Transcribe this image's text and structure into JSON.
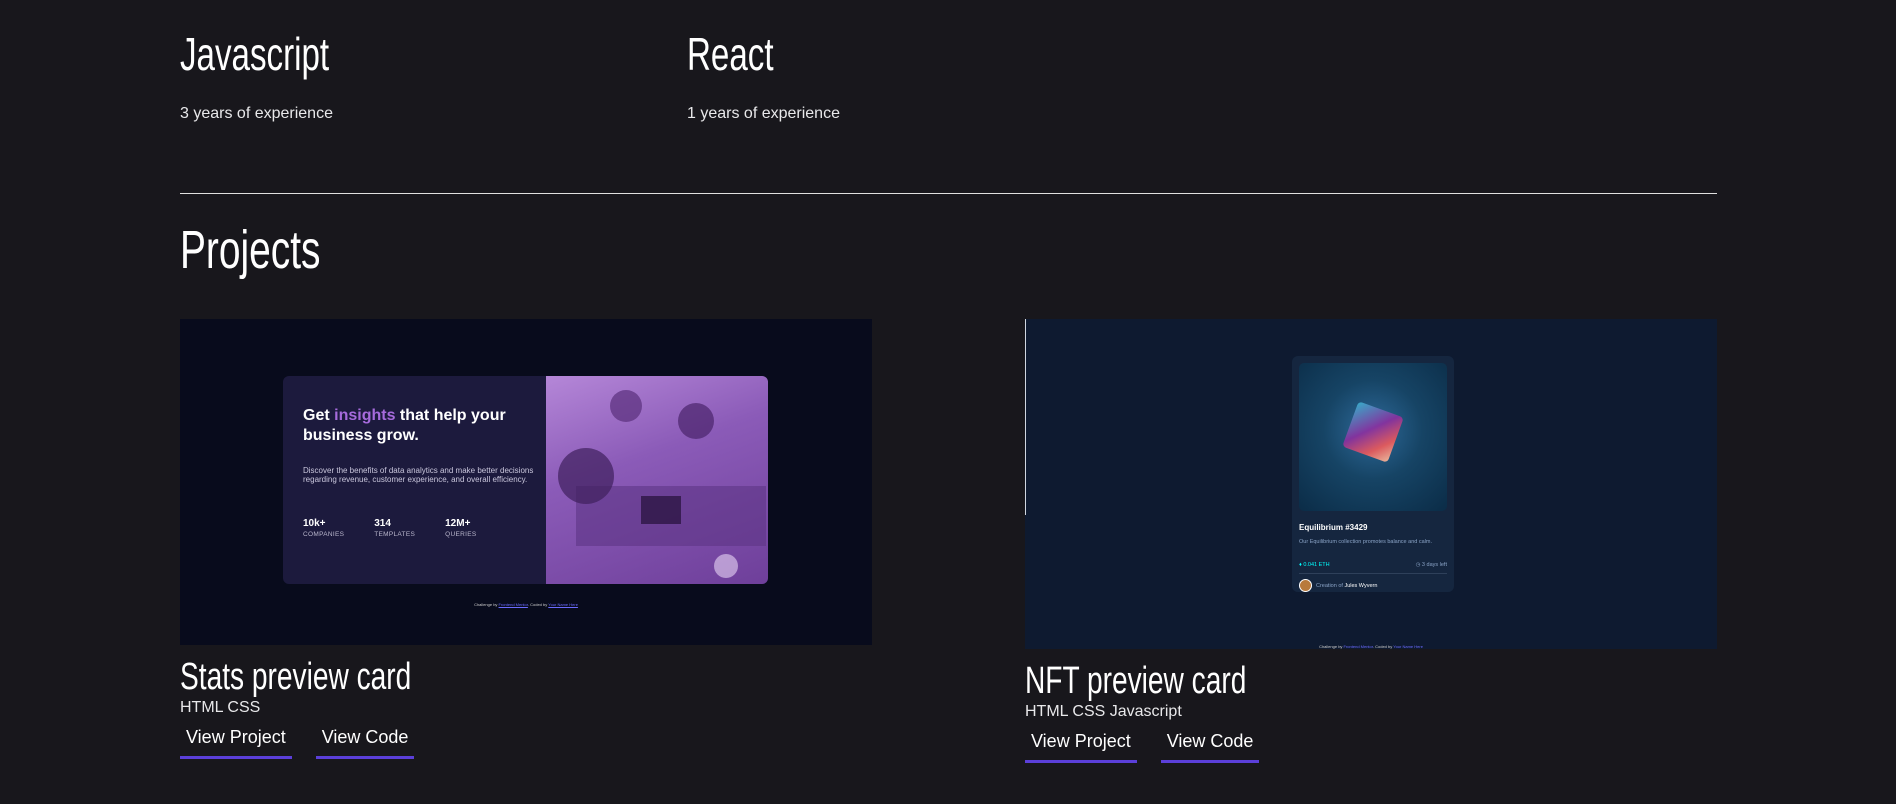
{
  "skills": [
    {
      "name": "Javascript",
      "experience": "3 years of experience"
    },
    {
      "name": "React",
      "experience": "1 years of experience"
    }
  ],
  "projects_section": {
    "title": "Projects"
  },
  "projects": [
    {
      "title": "Stats preview card",
      "tech": "HTML CSS",
      "view_project_label": "View Project",
      "view_code_label": "View Code",
      "thumbnail": {
        "heading_pre": "Get ",
        "heading_accent": "insights",
        "heading_post": " that help your business grow.",
        "body": "Discover the benefits of data analytics and make better decisions regarding revenue, customer experience, and overall efficiency.",
        "stats": [
          {
            "value": "10k+",
            "label": "COMPANIES"
          },
          {
            "value": "314",
            "label": "TEMPLATES"
          },
          {
            "value": "12M+",
            "label": "QUERIES"
          }
        ],
        "attribution_pre": "Challenge by ",
        "attribution_link1": "Frontend Mentor",
        "attribution_mid": ". Coded by ",
        "attribution_link2": "Your Name Here",
        "accent_color": "#a66bdc"
      }
    },
    {
      "title": "NFT preview card",
      "tech": "HTML CSS Javascript",
      "view_project_label": "View Project",
      "view_code_label": "View Code",
      "thumbnail": {
        "name": "Equilibrium #3429",
        "description": "Our Equilibrium collection promotes balance and calm.",
        "price": "0.041 ETH",
        "time_left": "3 days left",
        "creator_pre": "Creation of ",
        "creator_name": "Jules Wyvern",
        "attribution_pre": "Challenge by ",
        "attribution_link1": "Frontend Mentor",
        "attribution_mid": ". Coded by ",
        "attribution_link2": "Your Name Here"
      }
    }
  ],
  "colors": {
    "background": "#18171c",
    "link_underline": "#5b3fd9",
    "text": "#ffffff"
  }
}
